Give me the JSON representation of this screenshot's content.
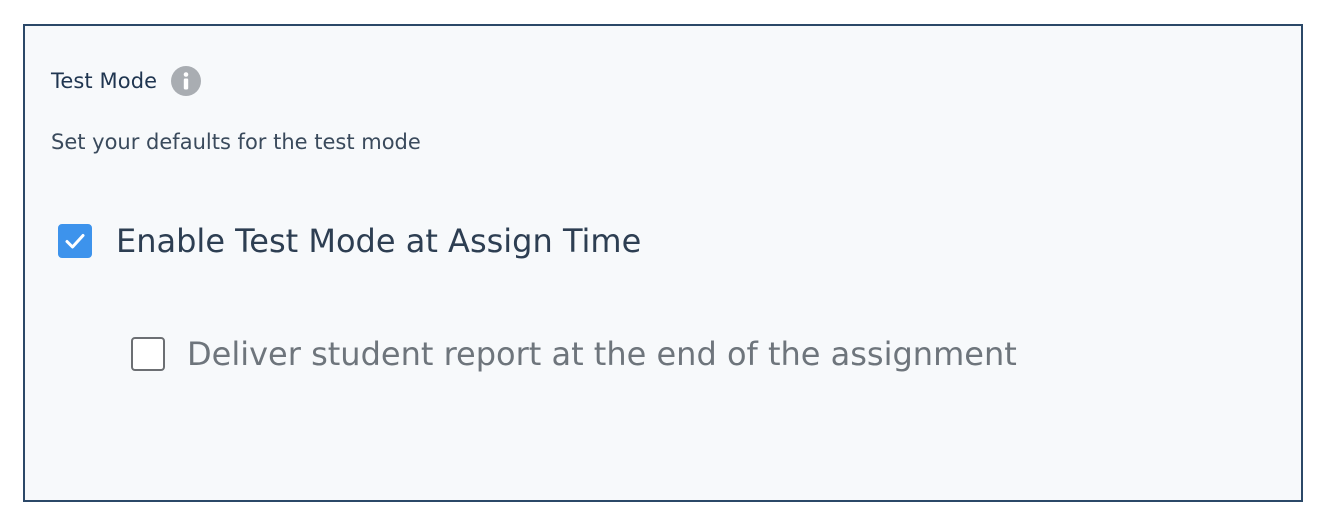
{
  "section": {
    "title": "Test Mode",
    "info_icon": "info-icon",
    "subtitle": "Set your defaults for the test mode"
  },
  "options": [
    {
      "label": "Enable Test Mode at Assign Time",
      "checked": true
    },
    {
      "label": "Deliver student report at the end of the assignment",
      "checked": false
    }
  ],
  "colors": {
    "panel_border": "#2b4868",
    "panel_background": "#f7f9fb",
    "checkbox_checked": "#3d93ec",
    "checkbox_unchecked_border": "#6c6f73",
    "info_icon_bg": "#a9adb2"
  }
}
